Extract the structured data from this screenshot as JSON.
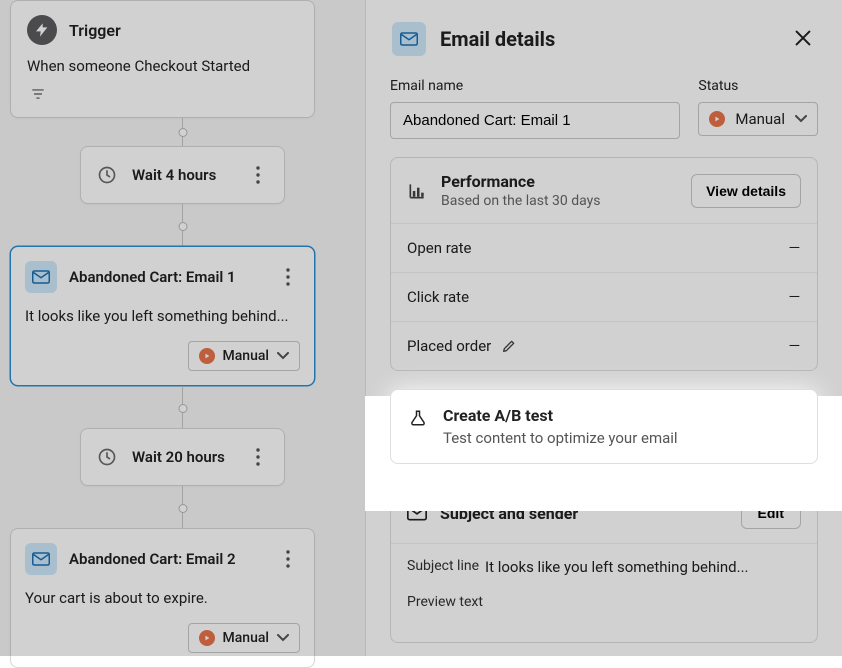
{
  "flow": {
    "trigger": {
      "title": "Trigger",
      "description": "When someone Checkout Started"
    },
    "nodes": [
      {
        "type": "wait",
        "label": "Wait 4 hours"
      },
      {
        "type": "email",
        "title": "Abandoned Cart: Email 1",
        "preview": "It looks like you left something behind...",
        "status": "Manual",
        "selected": true
      },
      {
        "type": "wait",
        "label": "Wait 20 hours"
      },
      {
        "type": "email",
        "title": "Abandoned Cart: Email 2",
        "preview": "Your cart is about to expire.",
        "status": "Manual",
        "selected": false
      }
    ]
  },
  "panel": {
    "title": "Email details",
    "email_name": {
      "label": "Email name",
      "value": "Abandoned Cart: Email 1"
    },
    "status": {
      "label": "Status",
      "value": "Manual"
    },
    "performance": {
      "title": "Performance",
      "subtitle": "Based on the last 30 days",
      "view_label": "View details",
      "rows": {
        "open_rate": {
          "label": "Open rate",
          "value": "–"
        },
        "click_rate": {
          "label": "Click rate",
          "value": "–"
        },
        "placed_order": {
          "label": "Placed order",
          "value": "–"
        }
      }
    },
    "abtest": {
      "title": "Create A/B test",
      "subtitle": "Test content to optimize your email"
    },
    "subject": {
      "title": "Subject and sender",
      "edit_label": "Edit",
      "subject_line_label": "Subject line",
      "subject_line": "It looks like you left something behind...",
      "preview_text_label": "Preview text"
    }
  }
}
